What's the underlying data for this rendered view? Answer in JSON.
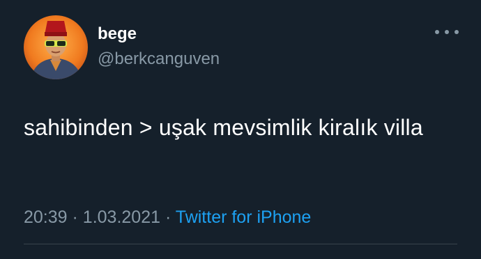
{
  "tweet": {
    "display_name": "bege",
    "handle": "@berkcanguven",
    "text": "sahibinden > uşak mevsimlik kiralık villa",
    "time": "20:39",
    "separator": "·",
    "date": "1.03.2021",
    "source": "Twitter for iPhone"
  },
  "icons": {
    "more": "more-horizontal-icon",
    "avatar": "avatar"
  },
  "colors": {
    "background": "#15202b",
    "primary_text": "#ffffff",
    "secondary_text": "#8899a6",
    "accent": "#1da1f2",
    "divider": "#38444d"
  }
}
